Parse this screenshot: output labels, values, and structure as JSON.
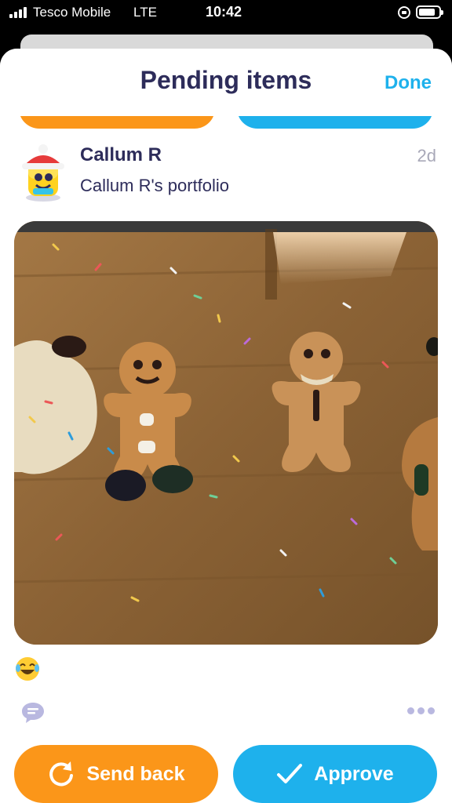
{
  "status_bar": {
    "carrier": "Tesco Mobile",
    "network": "LTE",
    "time": "10:42"
  },
  "header": {
    "title": "Pending items",
    "done_label": "Done"
  },
  "post": {
    "author": "Callum R",
    "portfolio": "Callum R's portfolio",
    "age": "2d",
    "photo_icon": "gingerbread-photo",
    "reaction_icon": "laughing-emoji-icon"
  },
  "actions": {
    "send_back_label": "Send back",
    "approve_label": "Approve"
  },
  "colors": {
    "orange": "#fb9619",
    "blue": "#1eb1ec",
    "title": "#2d2c5a"
  }
}
